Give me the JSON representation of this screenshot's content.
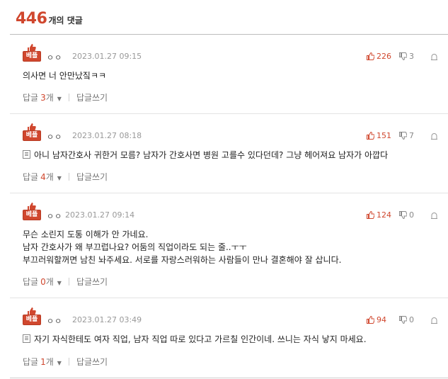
{
  "header": {
    "count": "446",
    "count_suffix": "개의 댓글"
  },
  "labels": {
    "best_tag": "베플",
    "reply_label": "답글",
    "reply_unit": "개",
    "write_reply": "답글쓰기"
  },
  "colors": {
    "accent": "#d0472e"
  },
  "comments": [
    {
      "user": "ㅇㅇ",
      "date": "2023.01.27 09:15",
      "up": "226",
      "down": "3",
      "has_memo_icon": false,
      "text": "의사면 너 안만났짘ㅋㅋ",
      "reply_count": "3"
    },
    {
      "user": "ㅇㅇ",
      "date": "2023.01.27 08:18",
      "up": "151",
      "down": "7",
      "has_memo_icon": true,
      "text": "아니 남자간호사 귀한거 모름? 남자가 간호사면 병원 고를수 있다던데? 그냥 헤어져요 남자가 아깝다",
      "reply_count": "4"
    },
    {
      "user": "ㅇㅇ",
      "date": "2023.01.27 09:14",
      "up": "124",
      "down": "0",
      "has_memo_icon": false,
      "text": "무슨 소린지 도통 이해가 안 가네요.\n남자 간호사가 왜 부끄럽나요? 어둠의 직업이라도 되는 줄..ㅜㅜ\n부끄러워할꺼면 남친 놔주세요. 서로를 자랑스러워하는 사람들이 만나 결혼해야 잘 삽니다.",
      "reply_count": "0"
    },
    {
      "user": "ㅇㅇ",
      "date": "2023.01.27 03:49",
      "up": "94",
      "down": "0",
      "has_memo_icon": true,
      "text": "자기 자식한테도 여자 직업, 남자 직업 따로 있다고 가르칠 인간이네. 쓰니는 자식 낳지 마세요.",
      "reply_count": "1"
    }
  ]
}
